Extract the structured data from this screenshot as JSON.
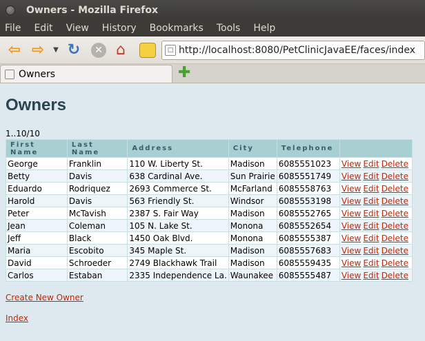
{
  "window": {
    "title": "Owners - Mozilla Firefox"
  },
  "menu": [
    "File",
    "Edit",
    "View",
    "History",
    "Bookmarks",
    "Tools",
    "Help"
  ],
  "nav": {
    "url": "http://localhost:8080/PetClinicJavaEE/faces/index"
  },
  "tab": {
    "label": "Owners"
  },
  "page": {
    "heading": "Owners",
    "range": "1..10/10",
    "columns": [
      "First Name",
      "Last Name",
      "Address",
      "City",
      "Telephone"
    ],
    "rows": [
      [
        "George",
        "Franklin",
        "110 W. Liberty St.",
        "Madison",
        "6085551023"
      ],
      [
        "Betty",
        "Davis",
        "638 Cardinal Ave.",
        "Sun Prairie",
        "6085551749"
      ],
      [
        "Eduardo",
        "Rodriquez",
        "2693 Commerce St.",
        "McFarland",
        "6085558763"
      ],
      [
        "Harold",
        "Davis",
        "563 Friendly St.",
        "Windsor",
        "6085553198"
      ],
      [
        "Peter",
        "McTavish",
        "2387 S. Fair Way",
        "Madison",
        "6085552765"
      ],
      [
        "Jean",
        "Coleman",
        "105 N. Lake St.",
        "Monona",
        "6085552654"
      ],
      [
        "Jeff",
        "Black",
        "1450 Oak Blvd.",
        "Monona",
        "6085555387"
      ],
      [
        "Maria",
        "Escobito",
        "345 Maple St.",
        "Madison",
        "6085557683"
      ],
      [
        "David",
        "Schroeder",
        "2749 Blackhawk Trail",
        "Madison",
        "6085559435"
      ],
      [
        "Carlos",
        "Estaban",
        "2335 Independence La.",
        "Waunakee",
        "6085555487"
      ]
    ],
    "actions": {
      "view": "View",
      "edit": "Edit",
      "delete": "Delete"
    },
    "create_link": "Create New Owner",
    "index_link": "Index"
  }
}
